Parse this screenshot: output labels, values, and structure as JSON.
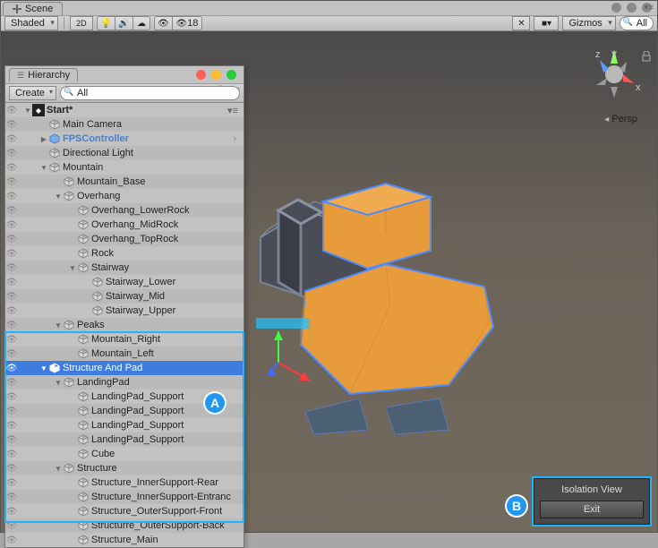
{
  "scene_tab": "Scene",
  "shading_mode": "Shaded",
  "two_d_label": "2D",
  "audio_count": "18",
  "gizmos_label": "Gizmos",
  "search_placeholder": "All",
  "persp_label": "Persp",
  "axes": {
    "x": "x",
    "y": "y",
    "z": "z"
  },
  "hierarchy": {
    "tab": "Hierarchy",
    "create": "Create",
    "search_placeholder": "All",
    "scene_name": "Start*",
    "items": {
      "main_camera": "Main Camera",
      "fps": "FPSController",
      "dir_light": "Directional Light",
      "mountain": "Mountain",
      "mountain_base": "Mountain_Base",
      "overhang": "Overhang",
      "overhang_lower": "Overhang_LowerRock",
      "overhang_mid": "Overhang_MidRock",
      "overhang_top": "Overhang_TopRock",
      "rock": "Rock",
      "stairway": "Stairway",
      "stair_lower": "Stairway_Lower",
      "stair_mid": "Stairway_Mid",
      "stair_upper": "Stairway_Upper",
      "peaks": "Peaks",
      "mt_right": "Mountain_Right",
      "mt_left": "Mountain_Left",
      "struct_pad": "Structure And Pad",
      "landing": "LandingPad",
      "lp_sup1": "LandingPad_Support",
      "lp_sup2": "LandingPad_Support",
      "lp_sup3": "LandingPad_Support",
      "lp_sup4": "LandingPad_Support",
      "cube": "Cube",
      "structure": "Structure",
      "st_inner_rear": "Structure_InnerSupport-Rear",
      "st_inner_ent": "Structure_InnerSupport-Entranc",
      "st_outer_front": "Structure_OuterSupport-Front",
      "st_outer_back": "Structurre_OuterSupport-Back",
      "st_main": "Structure_Main"
    }
  },
  "isolation": {
    "title": "Isolation View",
    "exit": "Exit"
  },
  "labels": {
    "a": "A",
    "b": "B"
  }
}
